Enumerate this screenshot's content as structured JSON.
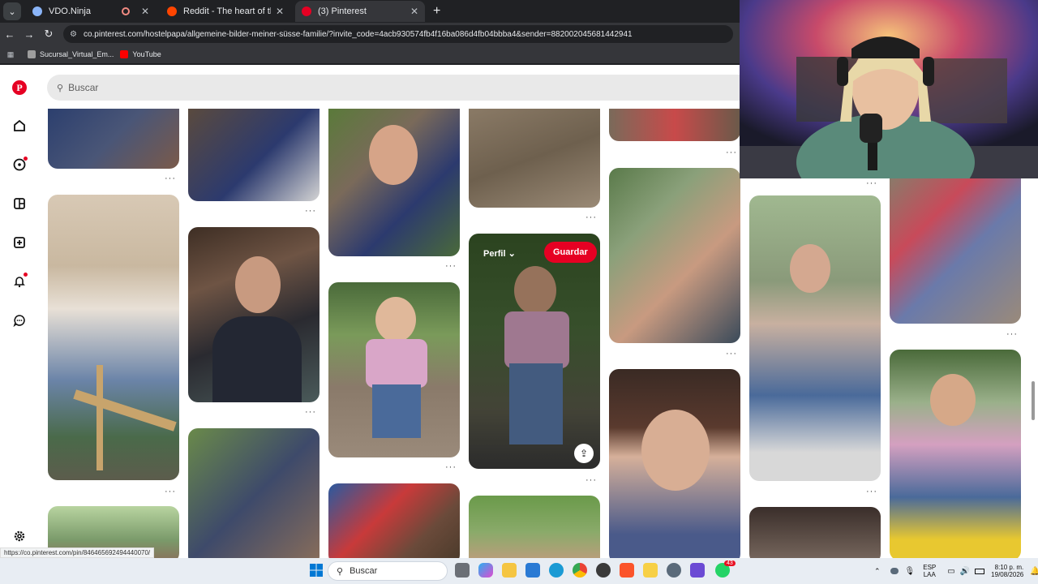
{
  "browser": {
    "tabs": [
      {
        "title": "VDO.Ninja",
        "color": "#8ab4f8",
        "recording": true
      },
      {
        "title": "Reddit - The heart of the intern",
        "color": "#ff4500"
      },
      {
        "title": "(3) Pinterest",
        "color": "#e60023",
        "active": true
      }
    ],
    "url": "co.pinterest.com/hostelpapa/allgemeine-bilder-meiner-süsse-familie/?invite_code=4acb930574fb4f16ba086d4fb04bbba4&sender=882002045681442941",
    "bookmarks": [
      {
        "label": "Sucursal_Virtual_Em...",
        "color": "#9e9e9e"
      },
      {
        "label": "YouTube",
        "color": "#ff0000"
      }
    ]
  },
  "pinterest": {
    "search_placeholder": "Buscar",
    "hover_pin": {
      "profile_label": "Perfil",
      "save_label": "Guardar"
    },
    "more_label": "···"
  },
  "status_url": "https://co.pinterest.com/pin/846465692494440070/",
  "taskbar": {
    "search_placeholder": "Buscar",
    "lang": "ESP",
    "layout": "LAA",
    "time": "8:10 p. m.",
    "date": "19/08/2026",
    "whatsapp_badge": "43"
  },
  "colors": {
    "pinterest_red": "#e60023"
  }
}
